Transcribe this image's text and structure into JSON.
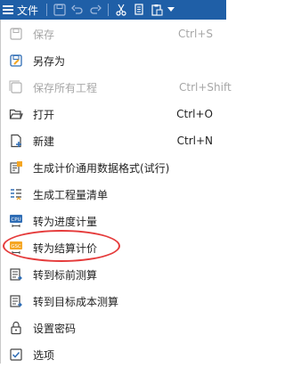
{
  "toolbar": {
    "file_label": "文件",
    "icons": [
      "save-icon",
      "undo-icon",
      "redo-icon",
      "cut-icon",
      "copy-icon",
      "paste-icon",
      "dropdown-icon"
    ]
  },
  "menu": {
    "items": [
      {
        "label": "保存",
        "shortcut": "Ctrl+S",
        "enabled": false,
        "icon": "save-icon"
      },
      {
        "label": "另存为",
        "shortcut": "",
        "enabled": true,
        "icon": "save-as-icon"
      },
      {
        "label": "保存所有工程",
        "shortcut": "Ctrl+Shift",
        "enabled": false,
        "icon": "save-all-icon"
      },
      {
        "label": "打开",
        "shortcut": "Ctrl+O",
        "enabled": true,
        "icon": "open-folder-icon"
      },
      {
        "label": "新建",
        "shortcut": "Ctrl+N",
        "enabled": true,
        "icon": "new-file-icon"
      },
      {
        "label": "生成计价通用数据格式(试行)",
        "shortcut": "",
        "enabled": true,
        "icon": "generate-data-icon"
      },
      {
        "label": "生成工程量清单",
        "shortcut": "",
        "enabled": true,
        "icon": "quantity-list-icon"
      },
      {
        "label": "转为进度计量",
        "shortcut": "",
        "enabled": true,
        "icon": "progress-measure-icon"
      },
      {
        "label": "转为结算计价",
        "shortcut": "",
        "enabled": true,
        "icon": "settlement-icon"
      },
      {
        "label": "转到标前测算",
        "shortcut": "",
        "enabled": true,
        "icon": "pre-bid-icon"
      },
      {
        "label": "转到目标成本测算",
        "shortcut": "",
        "enabled": true,
        "icon": "target-cost-icon"
      },
      {
        "label": "设置密码",
        "shortcut": "",
        "enabled": true,
        "icon": "lock-icon"
      },
      {
        "label": "选项",
        "shortcut": "",
        "enabled": true,
        "icon": "options-icon"
      }
    ]
  },
  "colors": {
    "toolbar_bg": "#1f5fa7",
    "disabled_text": "#a6a6a6",
    "highlight": "#e53b3b",
    "icon_accent": "#f5a623"
  }
}
